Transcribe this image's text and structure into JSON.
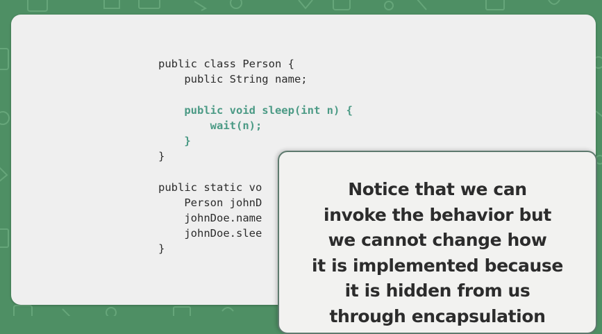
{
  "slide": {
    "background_color": "#4e8f64",
    "panel_color": "#efefef",
    "code_highlight_color": "#4b9a85"
  },
  "code": {
    "lines": [
      {
        "text": "public class Person {",
        "highlight": false
      },
      {
        "text": "    public String name;",
        "highlight": false
      },
      {
        "text": "",
        "highlight": false
      },
      {
        "text": "    public void sleep(int n) {",
        "highlight": true
      },
      {
        "text": "        wait(n);",
        "highlight": true
      },
      {
        "text": "    }",
        "highlight": true
      },
      {
        "text": "}",
        "highlight": false
      },
      {
        "text": "",
        "highlight": false
      },
      {
        "text": "public static vo",
        "highlight": false
      },
      {
        "text": "    Person johnD",
        "highlight": false
      },
      {
        "text": "    johnDoe.name",
        "highlight": false
      },
      {
        "text": "    johnDoe.slee",
        "highlight": false
      },
      {
        "text": "}",
        "highlight": false
      }
    ]
  },
  "callout": {
    "lines": [
      "Notice that we can",
      "invoke the behavior but",
      "we cannot change how",
      "it is implemented because",
      "it is hidden from us",
      "through encapsulation"
    ]
  }
}
